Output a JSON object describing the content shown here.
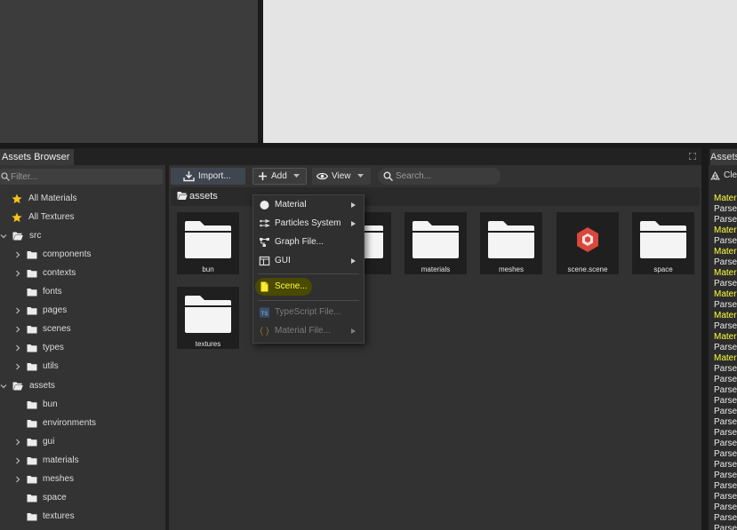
{
  "panel": {
    "title": "Assets Browser",
    "filter_placeholder": "Filter..."
  },
  "console": {
    "tab_title": "Assets",
    "clear_label": "Cle",
    "lines": [
      {
        "text": "Materi",
        "level": "warn"
      },
      {
        "text": "Parsec",
        "level": "info"
      },
      {
        "text": "Parsec",
        "level": "info"
      },
      {
        "text": "Materi",
        "level": "warn"
      },
      {
        "text": "Parsec",
        "level": "info"
      },
      {
        "text": "Materi",
        "level": "warn"
      },
      {
        "text": "Parsec",
        "level": "info"
      },
      {
        "text": "Materi",
        "level": "warn"
      },
      {
        "text": "Parsec",
        "level": "info"
      },
      {
        "text": "Materi",
        "level": "warn"
      },
      {
        "text": "Parsec",
        "level": "info"
      },
      {
        "text": "Materi",
        "level": "warn"
      },
      {
        "text": "Parsec",
        "level": "info"
      },
      {
        "text": "Materi",
        "level": "warn"
      },
      {
        "text": "Parsec",
        "level": "info"
      },
      {
        "text": "Materi",
        "level": "warn"
      },
      {
        "text": "Parsec",
        "level": "info"
      },
      {
        "text": "Parsec",
        "level": "info"
      },
      {
        "text": "Parsec",
        "level": "info"
      },
      {
        "text": "Parsec",
        "level": "info"
      },
      {
        "text": "Parsec",
        "level": "info"
      },
      {
        "text": "Parsec",
        "level": "info"
      },
      {
        "text": "Parsec",
        "level": "info"
      },
      {
        "text": "Parsec",
        "level": "info"
      },
      {
        "text": "Parsec",
        "level": "info"
      },
      {
        "text": "Parsec",
        "level": "info"
      },
      {
        "text": "Parsec",
        "level": "info"
      },
      {
        "text": "Parsec",
        "level": "info"
      },
      {
        "text": "Parsec",
        "level": "info"
      },
      {
        "text": "Parsec",
        "level": "info"
      },
      {
        "text": "Parsec",
        "level": "info"
      },
      {
        "text": "Parsec",
        "level": "info"
      }
    ]
  },
  "tree": {
    "items": [
      {
        "label": "All Materials",
        "icon": "star-icon",
        "expander": "none"
      },
      {
        "label": "All Textures",
        "icon": "star-icon",
        "expander": "none"
      },
      {
        "label": "src",
        "icon": "folder-open-icon",
        "expander": "expanded"
      },
      {
        "label": "components",
        "icon": "folder-icon",
        "expander": "collapsed"
      },
      {
        "label": "contexts",
        "icon": "folder-icon",
        "expander": "collapsed"
      },
      {
        "label": "fonts",
        "icon": "folder-icon",
        "expander": "none"
      },
      {
        "label": "pages",
        "icon": "folder-icon",
        "expander": "collapsed"
      },
      {
        "label": "scenes",
        "icon": "folder-icon",
        "expander": "collapsed"
      },
      {
        "label": "types",
        "icon": "folder-icon",
        "expander": "collapsed"
      },
      {
        "label": "utils",
        "icon": "folder-icon",
        "expander": "collapsed"
      },
      {
        "label": "assets",
        "icon": "folder-open-icon",
        "expander": "expanded"
      },
      {
        "label": "bun",
        "icon": "folder-icon",
        "expander": "none"
      },
      {
        "label": "environments",
        "icon": "folder-icon",
        "expander": "none"
      },
      {
        "label": "gui",
        "icon": "folder-icon",
        "expander": "collapsed"
      },
      {
        "label": "materials",
        "icon": "folder-icon",
        "expander": "collapsed"
      },
      {
        "label": "meshes",
        "icon": "folder-icon",
        "expander": "collapsed"
      },
      {
        "label": "space",
        "icon": "folder-icon",
        "expander": "none"
      },
      {
        "label": "textures",
        "icon": "folder-icon",
        "expander": "none"
      }
    ]
  },
  "toolbar": {
    "import_label": "Import...",
    "add_label": "Add",
    "view_label": "View",
    "search_placeholder": "Search..."
  },
  "breadcrumb": {
    "path": "assets"
  },
  "grid": {
    "items": [
      {
        "label": "bun",
        "icon": "folder-icon"
      },
      {
        "label": "",
        "icon": "folder-icon"
      },
      {
        "label": "",
        "icon": "folder-icon"
      },
      {
        "label": "materials",
        "icon": "folder-icon"
      },
      {
        "label": "meshes",
        "icon": "folder-icon"
      },
      {
        "label": "scene.scene",
        "icon": "scene-file-icon"
      },
      {
        "label": "space",
        "icon": "folder-icon"
      },
      {
        "label": "textures",
        "icon": "folder-icon"
      }
    ]
  },
  "add_menu": {
    "items": [
      {
        "label": "Material",
        "icon": "circle-icon",
        "submenu": true,
        "disabled": false
      },
      {
        "label": "Particles System",
        "icon": "particles-icon",
        "submenu": true,
        "disabled": false
      },
      {
        "label": "Graph File...",
        "icon": "graph-icon",
        "submenu": false,
        "disabled": false
      },
      {
        "label": "GUI",
        "icon": "gui-icon",
        "submenu": true,
        "disabled": false
      },
      {
        "label": "Scene...",
        "icon": "scene-doc-icon",
        "submenu": false,
        "disabled": false,
        "highlighted": true
      },
      {
        "label": "TypeScript File...",
        "icon": "typescript-icon",
        "submenu": false,
        "disabled": true
      },
      {
        "label": "Material File...",
        "icon": "braces-icon",
        "submenu": true,
        "disabled": true
      }
    ]
  },
  "colors": {
    "highlight": "#4a4a00",
    "warning_text": "#ffff3a",
    "star": "#f5c518",
    "scene_icon": "#d9473d"
  }
}
